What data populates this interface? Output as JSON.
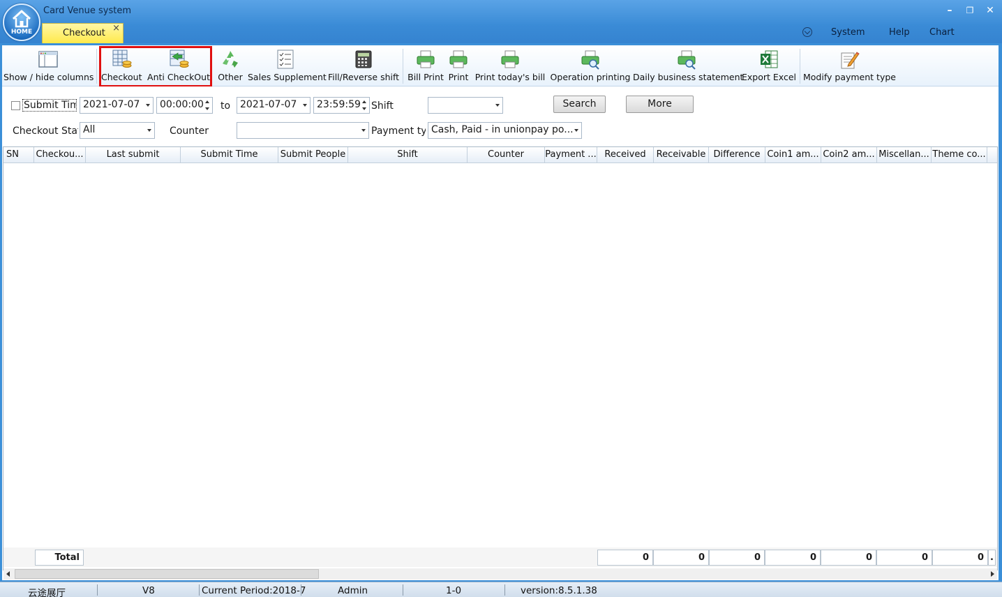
{
  "app": {
    "title": "Card Venue system",
    "home_label": "HOME"
  },
  "window_controls": {
    "minimize": "–",
    "restore": "❐",
    "close": "✕"
  },
  "tabs": [
    {
      "label": "Checkout",
      "close": "×"
    }
  ],
  "menu": {
    "system": "System",
    "help": "Help",
    "chart": "Chart"
  },
  "toolbar": {
    "show_hide_columns": "Show / hide columns",
    "checkout": "Checkout",
    "anti_checkout": "Anti CheckOut",
    "other": "Other",
    "sales_supplement": "Sales Supplement",
    "fill_reverse_shift": "Fill/Reverse shift",
    "bill_print": "Bill Print",
    "print": "Print",
    "print_today": "Print today's bill",
    "operation_printing": "Operation printing",
    "daily_statement": "Daily business statement",
    "export_excel": "Export Excel",
    "modify_payment": "Modify payment type"
  },
  "filters": {
    "submit_time_label": "Submit Tim",
    "start_date": "2021-07-07",
    "start_time": "00:00:00",
    "to_label": "to",
    "end_date": "2021-07-07",
    "end_time": "23:59:59",
    "shift_label": "Shift",
    "shift_value": "",
    "search_button": "Search",
    "more_button": "More",
    "checkout_status_label": "Checkout Stat",
    "checkout_status_value": "All",
    "counter_label": "Counter",
    "counter_value": "",
    "payment_type_label": "Payment ty",
    "payment_type_value": "Cash, Paid - in unionpay po..."
  },
  "grid": {
    "columns": [
      "SN",
      "Checkou...",
      "Last submit",
      "Submit Time",
      "Submit People",
      "Shift",
      "Counter",
      "Payment ...",
      "Received",
      "Receivable",
      "Difference",
      "Coin1 am...",
      "Coin2 am...",
      "Miscellan...",
      "Theme co..."
    ],
    "rows": [],
    "total_label": "Total",
    "totals": [
      "0",
      "0",
      "0",
      "0",
      "0",
      "0",
      "0",
      "."
    ]
  },
  "statusbar": {
    "venue": "云途展厅",
    "edition": "V8",
    "period": "Current Period:2018-7",
    "user": "Admin",
    "code": "1-0",
    "version": "version:8.5.1.38"
  },
  "colors": {
    "accent": "#3a8bd6",
    "tab_active": "#ffe94a",
    "highlight": "#e01010"
  }
}
